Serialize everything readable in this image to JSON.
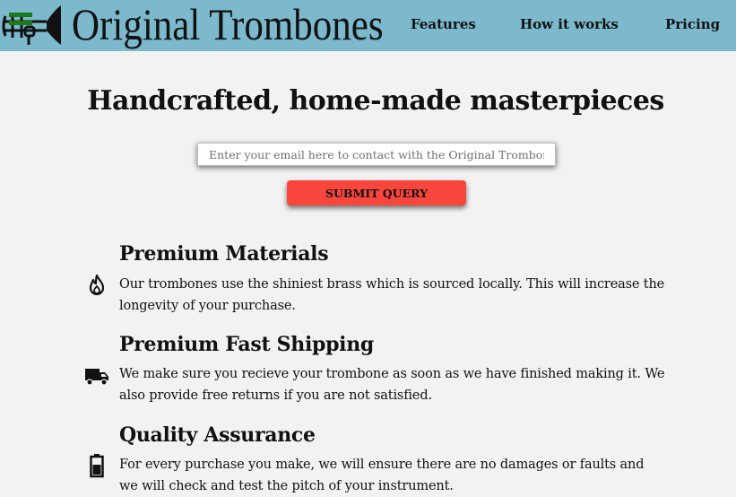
{
  "header": {
    "brand": "Original Trombones",
    "logo_icon": "trombone-logo-icon",
    "nav": [
      {
        "label": "Features"
      },
      {
        "label": "How it works"
      },
      {
        "label": "Pricing"
      }
    ],
    "background_color": "#7cb9cd"
  },
  "hero": {
    "title": "Handcrafted, home-made masterpieces",
    "email_placeholder": "Enter your email here to contact with the Original Trombones",
    "submit_label": "SUBMIT QUERY",
    "submit_color": "#f9463c"
  },
  "features": [
    {
      "icon": "fire-icon",
      "title": "Premium Materials",
      "description": "Our trombones use the shiniest brass which is sourced locally. This will increase the longevity of your purchase."
    },
    {
      "icon": "truck-icon",
      "title": "Premium Fast Shipping",
      "description": "We make sure you recieve your trombone as soon as we have finished making it. We also provide free returns if you are not satisfied."
    },
    {
      "icon": "battery-icon",
      "title": "Quality Assurance",
      "description": "For every purchase you make, we will ensure there are no damages or faults and we will check and test the pitch of your instrument."
    }
  ]
}
